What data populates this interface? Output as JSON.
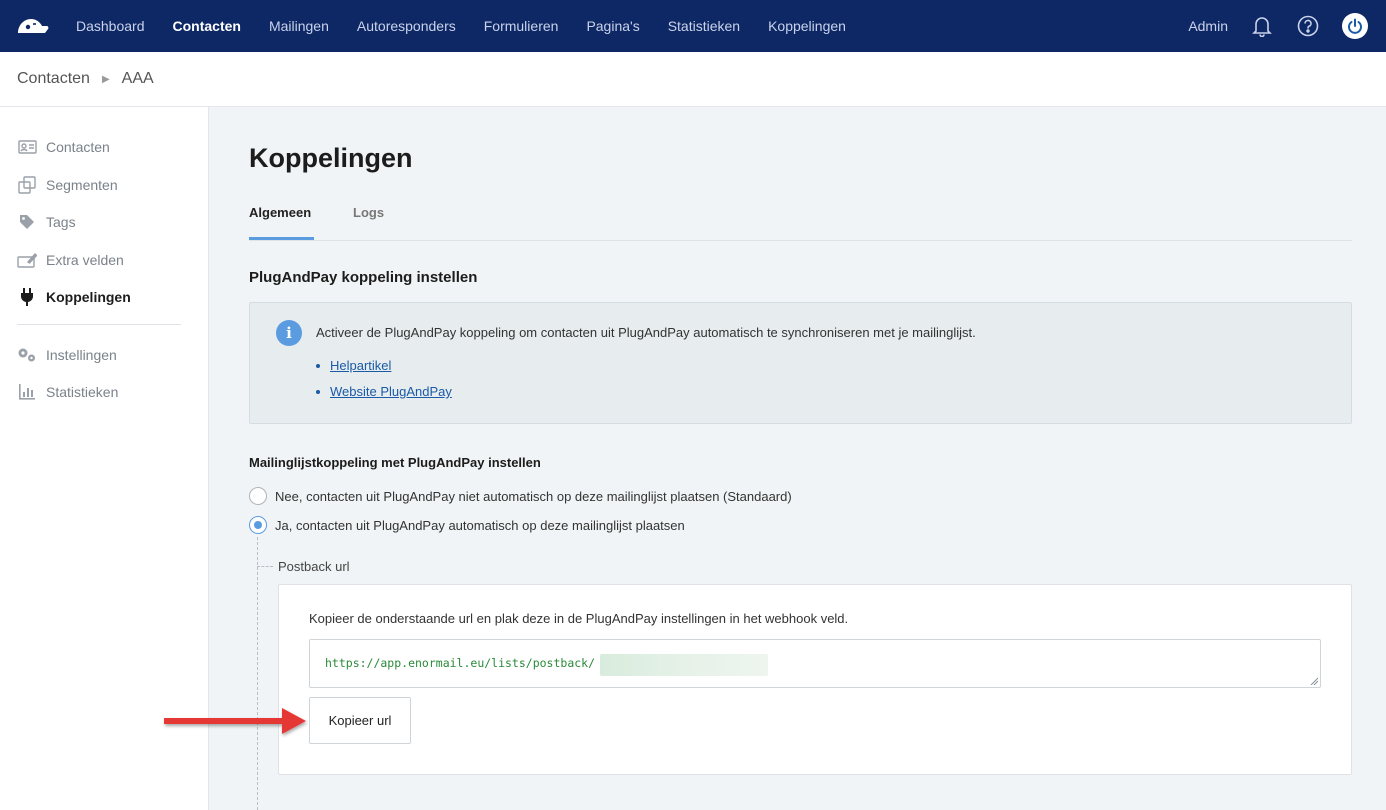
{
  "topnav": {
    "items": [
      "Dashboard",
      "Contacten",
      "Mailingen",
      "Autoresponders",
      "Formulieren",
      "Pagina's",
      "Statistieken",
      "Koppelingen"
    ],
    "active": "Contacten",
    "user_label": "Admin",
    "icons": [
      "bell-icon",
      "help-icon",
      "power-icon"
    ],
    "colors": {
      "bar": "#0e2765",
      "power_button": "#1a5aa6"
    }
  },
  "breadcrumb": {
    "items": [
      "Contacten",
      "AAA"
    ]
  },
  "sidebar": {
    "items": [
      {
        "label": "Contacten",
        "icon": "contact-card-icon"
      },
      {
        "label": "Segmenten",
        "icon": "segments-icon"
      },
      {
        "label": "Tags",
        "icon": "tag-icon"
      },
      {
        "label": "Extra velden",
        "icon": "edit-field-icon"
      },
      {
        "label": "Koppelingen",
        "icon": "plug-icon",
        "active": true
      },
      {
        "label": "Instellingen",
        "icon": "gears-icon"
      },
      {
        "label": "Statistieken",
        "icon": "bar-chart-icon"
      }
    ]
  },
  "main": {
    "title": "Koppelingen",
    "tabs": [
      "Algemeen",
      "Logs"
    ],
    "active_tab": "Algemeen",
    "section_title": "PlugAndPay koppeling instellen",
    "info": {
      "text": "Activeer de PlugAndPay koppeling om contacten uit PlugAndPay automatisch te synchroniseren met je mailinglijst.",
      "links": [
        "Helpartikel",
        "Website PlugAndPay"
      ]
    },
    "mailinglist": {
      "title": "Mailinglijstkoppeling met PlugAndPay instellen",
      "options": [
        {
          "label": "Nee, contacten uit PlugAndPay niet automatisch op deze mailinglijst plaatsen (Standaard)",
          "checked": false
        },
        {
          "label": "Ja, contacten uit PlugAndPay automatisch op deze mailinglijst plaatsen",
          "checked": true
        }
      ]
    },
    "postback": {
      "label": "Postback url",
      "instructions": "Kopieer de onderstaande url en plak deze in de PlugAndPay instellingen in het webhook veld.",
      "url": "https://app.enormail.eu/lists/postback/",
      "copy_button": "Kopieer url"
    },
    "colors": {
      "accent": "#5b9be0",
      "url_text": "#2a8a3a",
      "annotation_arrow": "#e53935"
    }
  }
}
